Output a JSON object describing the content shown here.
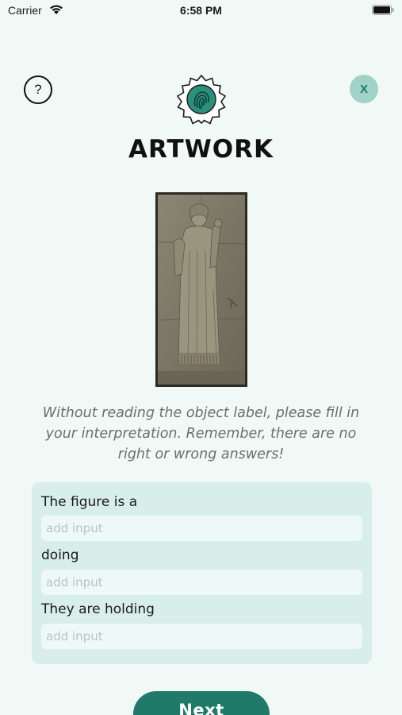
{
  "status_bar": {
    "carrier": "Carrier",
    "time": "6:58 PM"
  },
  "header": {
    "help_label": "?",
    "close_label": "X",
    "title": "ARTWORK",
    "logo_icon": "fingerprint-badge-icon"
  },
  "artwork": {
    "alt": "stone relief of a standing figure"
  },
  "instructions": "Without reading the object label, please fill in your interpretation. Remember, there are no right or wrong answers!",
  "form": {
    "fields": [
      {
        "label": "The figure is a",
        "placeholder": "add input",
        "value": ""
      },
      {
        "label": "doing",
        "placeholder": "add input",
        "value": ""
      },
      {
        "label": "They are holding",
        "placeholder": "add input",
        "value": ""
      }
    ]
  },
  "next_button": {
    "label": "Next"
  },
  "colors": {
    "background": "#f1f9f7",
    "accent": "#1f7a69",
    "card": "#d8eeea",
    "close_bg": "#9fd3c7"
  }
}
